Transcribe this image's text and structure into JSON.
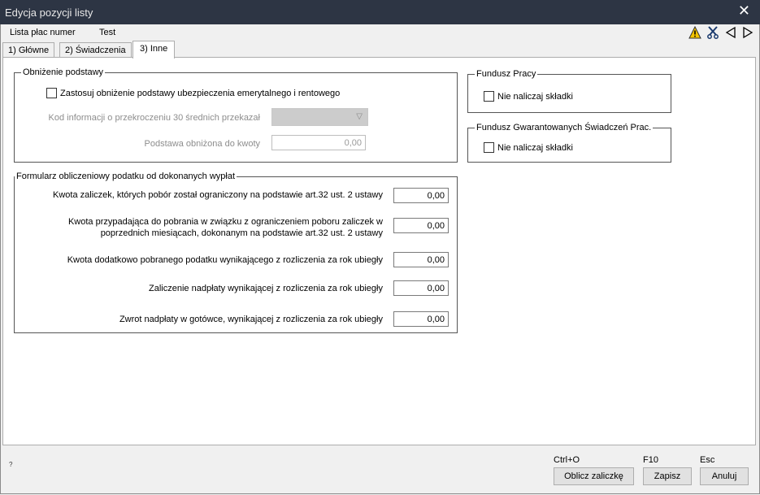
{
  "window": {
    "title": "Edycja pozycji listy",
    "close_glyph": "✕"
  },
  "header": {
    "label": "Lista płac numer",
    "value": "Test"
  },
  "toolbar": {
    "icons": [
      "warning-icon",
      "scissors-icon",
      "arrow-left-icon",
      "arrow-right-icon"
    ],
    "warning_color": "#f5c400"
  },
  "tabs": [
    {
      "label": "1) Główne"
    },
    {
      "label": "2) Świadczenia"
    },
    {
      "label": "3) Inne"
    }
  ],
  "obnizenie": {
    "legend": "Obniżenie podstawy",
    "checkbox_label": "Zastosuj obniżenie podstawy ubezpieczenia emerytalnego i rentowego",
    "kod_label": "Kod informacji o przekroczeniu 30 średnich przekazał",
    "kod_value": "",
    "podstawa_label": "Podstawa obniżona do kwoty",
    "podstawa_value": "0,00"
  },
  "formularz": {
    "legend": "Formularz obliczeniowy podatku od dokonanych wypłat",
    "rows": [
      {
        "label": "Kwota zaliczek, których pobór został ograniczony na podstawie art.32 ust. 2 ustawy",
        "value": "0,00"
      },
      {
        "label_line1": "Kwota przypadająca do pobrania w związku z ograniczeniem poboru zaliczek w",
        "label_line2": "poprzednich miesiącach, dokonanym na podstawie art.32 ust. 2 ustawy",
        "value": "0,00"
      },
      {
        "label": "Kwota dodatkowo pobranego podatku wynikającego z rozliczenia za rok ubiegły",
        "value": "0,00"
      },
      {
        "label": "Zaliczenie nadpłaty wynikającej z rozliczenia za rok ubiegły",
        "value": "0,00"
      },
      {
        "label": "Zwrot nadpłaty w gotówce, wynikającej z rozliczenia za rok ubiegły",
        "value": "0,00"
      }
    ]
  },
  "fundusz_pracy": {
    "legend": "Fundusz Pracy",
    "checkbox_label": "Nie naliczaj składki"
  },
  "fgsp": {
    "legend": "Fundusz Gwarantowanych Świadczeń Prac.",
    "checkbox_label": "Nie naliczaj składki"
  },
  "footer": {
    "help_label": "?",
    "buttons": [
      {
        "shortcut": "Ctrl+O",
        "label": "Oblicz zaliczkę"
      },
      {
        "shortcut": "F10",
        "label": "Zapisz"
      },
      {
        "shortcut": "Esc",
        "label": "Anuluj"
      }
    ]
  }
}
